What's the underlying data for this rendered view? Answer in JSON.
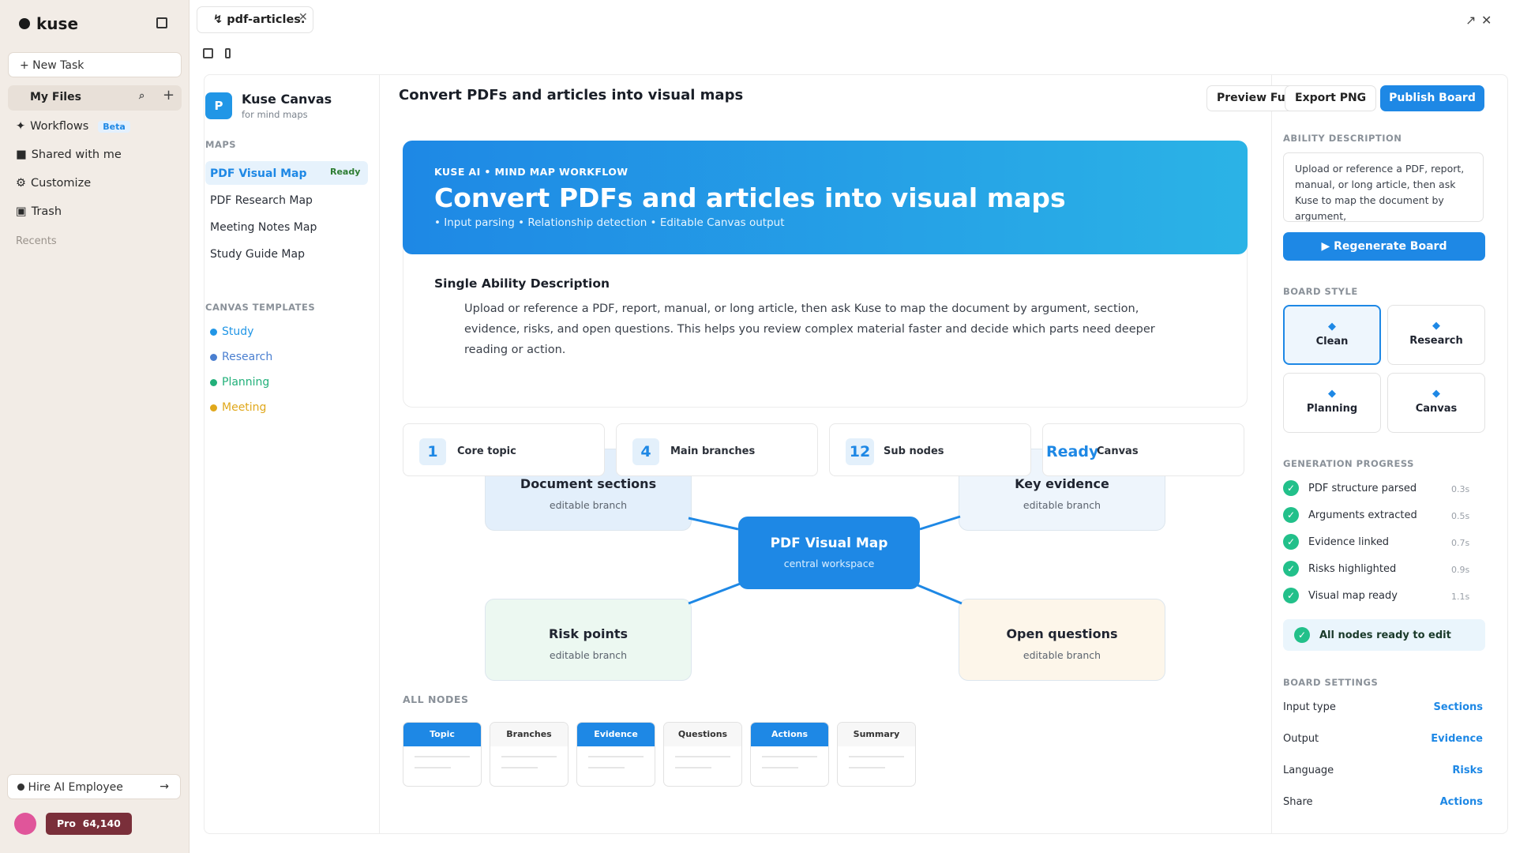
{
  "app": {
    "name": "kuse",
    "new_task": "+ New Task",
    "my_files": "My Files",
    "recents": "Recents",
    "nav": [
      {
        "icon": "✦",
        "label": "Workflows",
        "badge": "Beta"
      },
      {
        "icon": "■",
        "label": "Shared with me"
      },
      {
        "icon": "⚙",
        "label": "Customize"
      },
      {
        "icon": "▣",
        "label": "Trash"
      }
    ],
    "hire": "Hire AI Employee",
    "hire_arrow": "→",
    "pro_label": "Pro",
    "credits": "64,140"
  },
  "tab": {
    "label": "pdf-articles.",
    "icon": "↯",
    "close": "✕"
  },
  "window": {
    "expand": "↗",
    "close": "✕"
  },
  "canvas_app": {
    "logo_letter": "P",
    "name": "Kuse Canvas",
    "sub": "for mind maps"
  },
  "maps": {
    "section": "MAPS",
    "items": [
      "PDF Visual Map",
      "PDF Research Map",
      "Meeting Notes Map",
      "Study Guide Map"
    ],
    "active_badge": "Ready"
  },
  "templates": {
    "section": "CANVAS TEMPLATES",
    "items": [
      {
        "label": "Study",
        "color": "#2196e6"
      },
      {
        "label": "Research",
        "color": "#4a7fd0"
      },
      {
        "label": "Planning",
        "color": "#22b07a"
      },
      {
        "label": "Meeting",
        "color": "#e0a81c"
      }
    ]
  },
  "header": {
    "title": "Convert PDFs and articles into visual maps",
    "preview": "Preview Full",
    "export": "Export PNG",
    "publish": "Publish Board"
  },
  "hero": {
    "kicker": "KUSE AI • MIND MAP WORKFLOW",
    "title": "Convert PDFs and articles into visual maps",
    "sub": "• Input parsing • Relationship detection • Editable Canvas output"
  },
  "description": {
    "title": "Single Ability Description",
    "body": "Upload or reference a PDF, report, manual, or long article, then ask Kuse to map the document by argument, section, evidence, risks, and open questions. This helps you review complex material faster and decide which parts need deeper reading or action."
  },
  "stats": [
    {
      "value": "1",
      "label": "Core topic"
    },
    {
      "value": "4",
      "label": "Main branches"
    },
    {
      "value": "12",
      "label": "Sub nodes"
    },
    {
      "value": "Ready",
      "label": "Canvas"
    }
  ],
  "map": {
    "center_title": "PDF Visual Map",
    "center_sub": "central workspace",
    "branches": [
      {
        "title": "Document sections",
        "sub": "editable branch",
        "color": "#e3effb"
      },
      {
        "title": "Key evidence",
        "sub": "editable branch",
        "color": "#eef5fc"
      },
      {
        "title": "Risk points",
        "sub": "editable branch",
        "color": "#ecf8f1"
      },
      {
        "title": "Open questions",
        "sub": "editable branch",
        "color": "#fdf6ea"
      }
    ]
  },
  "all_nodes": {
    "section": "ALL NODES",
    "chips": [
      {
        "label": "Topic",
        "active": true
      },
      {
        "label": "Branches",
        "active": false
      },
      {
        "label": "Evidence",
        "active": true
      },
      {
        "label": "Questions",
        "active": false
      },
      {
        "label": "Actions",
        "active": true
      },
      {
        "label": "Summary",
        "active": false
      }
    ]
  },
  "right": {
    "ability_section": "ABILITY DESCRIPTION",
    "ability_text": "Upload or reference a PDF, report, manual, or long article, then ask Kuse to map the document by argument,",
    "regenerate": "▶ Regenerate Board",
    "style_section": "BOARD STYLE",
    "styles": [
      {
        "label": "Clean",
        "selected": true
      },
      {
        "label": "Research"
      },
      {
        "label": "Planning"
      },
      {
        "label": "Canvas"
      }
    ],
    "progress_section": "GENERATION PROGRESS",
    "progress": [
      {
        "label": "PDF structure parsed",
        "time": "0.3s"
      },
      {
        "label": "Arguments extracted",
        "time": "0.5s"
      },
      {
        "label": "Evidence linked",
        "time": "0.7s"
      },
      {
        "label": "Risks highlighted",
        "time": "0.9s"
      },
      {
        "label": "Visual map ready",
        "time": "1.1s"
      }
    ],
    "all_ready": "All nodes ready to edit",
    "settings_section": "BOARD SETTINGS",
    "settings": [
      {
        "label": "Input type",
        "value": "Sections"
      },
      {
        "label": "Output",
        "value": "Evidence"
      },
      {
        "label": "Language",
        "value": "Risks"
      },
      {
        "label": "Share",
        "value": "Actions"
      }
    ]
  }
}
